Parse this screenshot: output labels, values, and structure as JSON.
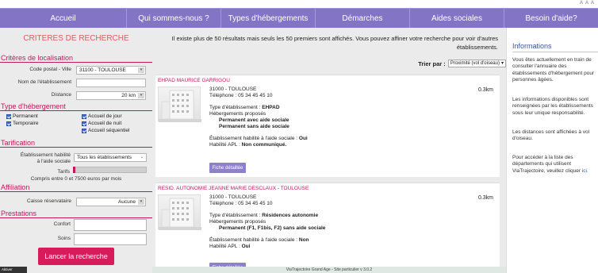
{
  "top": {
    "font_controls": "A A A"
  },
  "nav": [
    "Accueil",
    "Qui sommes-nous ?",
    "Types d'hébergements",
    "Démarches",
    "Aides sociales",
    "Besoin d'aide?"
  ],
  "sidebar": {
    "title": "CRITERES DE RECHERCHE",
    "localisation": {
      "heading": "Critères de localisation",
      "postal_label": "Code postal - Ville",
      "postal_value": "31100 - TOULOUSE",
      "name_label": "Nom de l'établissement",
      "name_value": "",
      "distance_label": "Distance",
      "distance_value": "20 km"
    },
    "hebergement": {
      "heading": "Type d'hébergement",
      "options": [
        "Permanent",
        "Temporaire",
        "Accueil de jour",
        "Accueil de nuit",
        "Accueil séquentiel"
      ]
    },
    "tarification": {
      "heading": "Tarification",
      "habilite_label_1": "Établissement habilité",
      "habilite_label_2": "à l'aide sociale",
      "habilite_value": "Tous les établissements",
      "tarifs_label": "Tarifs",
      "tarifs_range_text": "Compris entre 0 et 7500 euros par mois"
    },
    "affiliation": {
      "heading": "Affiliation",
      "caisse_label": "Caisse réservataire",
      "caisse_value": "Aucune"
    },
    "prestations": {
      "heading": "Prestations",
      "confort_label": "Confort",
      "soins_label": "Soins"
    },
    "search_button": "Lancer la recherche",
    "lang_tag": "Aktiver Windows"
  },
  "main": {
    "notice": "Il existe plus de 50 résultats mais seuls les 50 premiers sont affichés. Vous pouvez affiner votre recherche pour voir d'autres établissements.",
    "sort_label": "Trier par :",
    "sort_value": "Proximité (vol d'oiseau)",
    "results": [
      {
        "name": "EHPAD MAURICE GARRIGOU",
        "city": "31000 - TOULOUSE",
        "phone": "Téléphone : 05 34 45 45 10",
        "type_label": "Type d'établissement : ",
        "type_value": "EHPAD",
        "heb_label": "Hébergements proposés",
        "heb_items": [
          "Permanent avec aide sociale",
          "Permanent sans aide sociale"
        ],
        "habilite_label": "Établissement habilité à l'aide sociale : ",
        "habilite_value": "Oui",
        "apl_label": "Habilité APL : ",
        "apl_value": "Non communiqué.",
        "distance": "0.3km",
        "detail_button": "Fiche détaillée"
      },
      {
        "name": "RESID. AUTONOMIE JEANNE MARIE DESCLAUX - TOULOUSE",
        "city": "31000 - TOULOUSE",
        "phone": "Téléphone : 05 34 45 45 10",
        "type_label": "Type d'établissement : ",
        "type_value": "Résidences autonomie",
        "heb_label": "Hébergements proposés",
        "heb_items": [
          "Permanent (F1, F1bis, F2) sans aide sociale"
        ],
        "habilite_label": "Établissement habilité à l'aide sociale : ",
        "habilite_value": "Non",
        "apl_label": "Habilité APL : ",
        "apl_value": "Oui",
        "distance": "0.3km",
        "detail_button": "Fiche détaillée"
      }
    ]
  },
  "info": {
    "title": "Informations",
    "p1": "Vous êtes actuellement en train de consulter l'annuaire des établissements d'hébergement pour personnes âgées.",
    "p2": "Les informations disponibles sont renseignées par les établissements sous leur unique responsabilité.",
    "p3": "Les distances sont affichées à vol d'oiseau.",
    "p4": "Pour accéder à la liste des départements qui utilisent ViaTrajectoire, veuillez cliquer",
    "p4_link": "ici."
  },
  "footer": "ViaTrajectoire Grand Age - Site particulier v 3.0.2"
}
